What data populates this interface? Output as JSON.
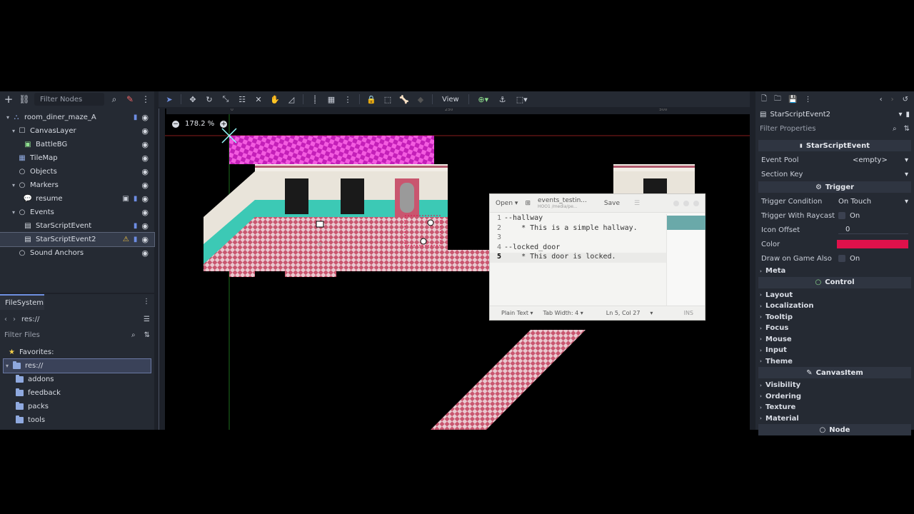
{
  "scene_dock": {
    "filter_placeholder": "Filter Nodes",
    "nodes": [
      {
        "label": "room_diner_maze_A",
        "indent": 0,
        "icon": "node2d-icon"
      },
      {
        "label": "CanvasLayer",
        "indent": 1,
        "icon": "canvaslayer-icon"
      },
      {
        "label": "BattleBG",
        "indent": 2,
        "icon": "sprite-icon"
      },
      {
        "label": "TileMap",
        "indent": 1,
        "icon": "tilemap-icon"
      },
      {
        "label": "Objects",
        "indent": 1,
        "icon": "node-icon"
      },
      {
        "label": "Markers",
        "indent": 1,
        "icon": "node-icon"
      },
      {
        "label": "resume",
        "indent": 2,
        "icon": "marker-icon"
      },
      {
        "label": "Events",
        "indent": 1,
        "icon": "node-icon"
      },
      {
        "label": "StarScriptEvent",
        "indent": 2,
        "icon": "control-icon"
      },
      {
        "label": "StarScriptEvent2",
        "indent": 2,
        "icon": "control-icon"
      },
      {
        "label": "Sound Anchors",
        "indent": 1,
        "icon": "node-icon"
      }
    ]
  },
  "filesystem": {
    "tab_label": "FileSystem",
    "path": "res://",
    "filter_placeholder": "Filter Files",
    "favorites_label": "Favorites:",
    "root_label": "res://",
    "folders": [
      "addons",
      "feedback",
      "packs",
      "tools"
    ]
  },
  "viewport": {
    "zoom": "178.2 %",
    "view_label": "View",
    "ruler_marks": [
      "0",
      "250",
      "500"
    ]
  },
  "text_editor": {
    "open_label": "Open",
    "title": "events_testin...",
    "subtitle": "HOO1 /media/pe...",
    "save_label": "Save",
    "lines": [
      {
        "num": "1",
        "code": "--hallway"
      },
      {
        "num": "2",
        "code": "    * This is a simple hallway."
      },
      {
        "num": "3",
        "code": ""
      },
      {
        "num": "4",
        "code": "--locked_door"
      },
      {
        "num": "5",
        "code": "    * This door is locked."
      }
    ],
    "footer": {
      "language": "Plain Text",
      "tab_width": "Tab Width: 4",
      "position": "Ln 5, Col 27",
      "mode": "INS"
    }
  },
  "inspector": {
    "object_name": "StarScriptEvent2",
    "filter_placeholder": "Filter Properties",
    "script_section": "StarScriptEvent",
    "event_pool_label": "Event Pool",
    "event_pool_value": "<empty>",
    "section_key_label": "Section Key",
    "trigger_section": "Trigger",
    "trigger_condition_label": "Trigger Condition",
    "trigger_condition_value": "On Touch",
    "trigger_raycast_label": "Trigger With Raycast",
    "trigger_raycast_value": "On",
    "icon_offset_label": "Icon Offset",
    "icon_offset_value": "0",
    "color_label": "Color",
    "color_value": "#e0114b",
    "draw_on_game_label": "Draw on Game Also",
    "draw_on_game_value": "On",
    "meta_label": "Meta",
    "control_section": "Control",
    "control_groups": [
      "Layout",
      "Localization",
      "Tooltip",
      "Focus",
      "Mouse",
      "Input",
      "Theme"
    ],
    "canvasitem_section": "CanvasItem",
    "canvasitem_groups": [
      "Visibility",
      "Ordering",
      "Texture",
      "Material"
    ],
    "node_section": "Node"
  }
}
